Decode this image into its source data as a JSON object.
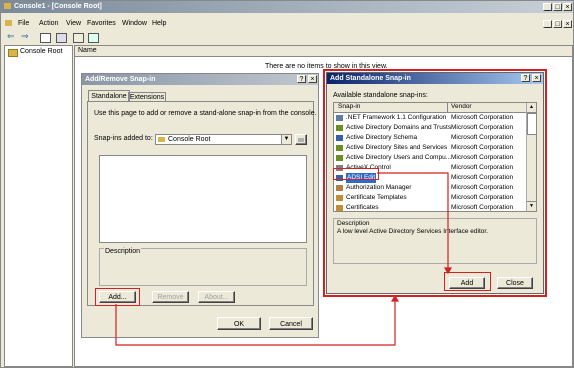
{
  "mmc": {
    "title": "Console1 - [Console Root]",
    "menu": [
      "File",
      "Action",
      "View",
      "Favorites",
      "Window",
      "Help"
    ],
    "tree_root": "Console Root",
    "column_name": "Name",
    "empty_message": "There are no items to show in this view."
  },
  "addremove": {
    "title": "Add/Remove Snap-in",
    "tabs": [
      "Standalone",
      "Extensions"
    ],
    "instructions": "Use this page to add or remove a stand-alone snap-in from the console.",
    "added_to_label": "Snap-ins added to:",
    "added_to_value": "Console Root",
    "description_label": "Description",
    "add_button": "Add...",
    "remove_button": "Remove",
    "about_button": "About...",
    "ok_button": "OK",
    "cancel_button": "Cancel"
  },
  "standalone": {
    "title": "Add Standalone Snap-in",
    "available_label": "Available standalone snap-ins:",
    "columns": [
      "Snap-in",
      "Vendor"
    ],
    "rows": [
      {
        "name": ".NET Framework 1.1 Configuration",
        "vendor": "Microsoft Corporation",
        "icon": "net-config-icon",
        "color": "#5f7fa0"
      },
      {
        "name": "Active Directory Domains and Trusts",
        "vendor": "Microsoft Corporation",
        "icon": "ad-domains-icon",
        "color": "#6b8e23"
      },
      {
        "name": "Active Directory Schema",
        "vendor": "Microsoft Corporation",
        "icon": "ad-schema-icon",
        "color": "#3b5ea8"
      },
      {
        "name": "Active Directory Sites and Services",
        "vendor": "Microsoft Corporation",
        "icon": "ad-sites-icon",
        "color": "#6b8e23"
      },
      {
        "name": "Active Directory Users and Compu...",
        "vendor": "Microsoft Corporation",
        "icon": "ad-users-icon",
        "color": "#6b8e23"
      },
      {
        "name": "ActiveX Control",
        "vendor": "Microsoft Corporation",
        "icon": "activex-icon",
        "color": "#808080"
      },
      {
        "name": "ADSI Edit",
        "vendor": "Microsoft Corporation",
        "icon": "adsi-edit-icon",
        "color": "#3b5ea8",
        "selected": true
      },
      {
        "name": "Authorization Manager",
        "vendor": "Microsoft Corporation",
        "icon": "authorization-icon",
        "color": "#b08040"
      },
      {
        "name": "Certificate Templates",
        "vendor": "Microsoft Corporation",
        "icon": "cert-templates-icon",
        "color": "#c09030"
      },
      {
        "name": "Certificates",
        "vendor": "Microsoft Corporation",
        "icon": "certificates-icon",
        "color": "#c09030"
      }
    ],
    "description_label": "Description",
    "description_text": "A low level Active Directory Services Interface editor.",
    "add_button": "Add",
    "close_button": "Close"
  },
  "colors": {
    "titlebar": "#0a246a",
    "titlebar_end": "#a6caf0",
    "highlight": "#d32020",
    "dialog_bg": "#ece9d8",
    "selection": "#316ac5"
  }
}
